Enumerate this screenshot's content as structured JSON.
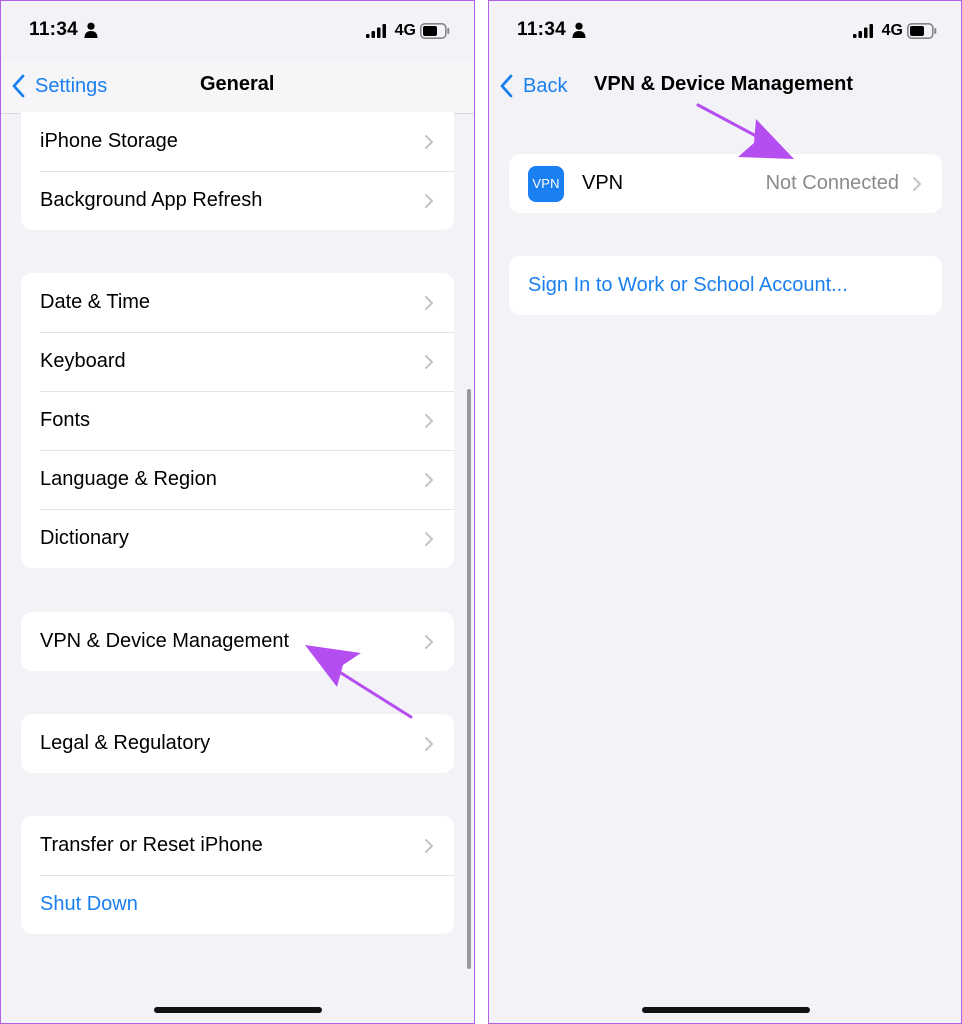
{
  "colors": {
    "accent": "#1a7ff0",
    "annotation_arrow": "#b44ef0",
    "secondary_text": "#8a8a8e"
  },
  "left": {
    "status": {
      "time": "11:34",
      "network": "4G"
    },
    "nav": {
      "back_label": "Settings",
      "title": "General"
    },
    "groups": [
      {
        "items": [
          {
            "label": "iPhone Storage"
          },
          {
            "label": "Background App Refresh"
          }
        ]
      },
      {
        "items": [
          {
            "label": "Date & Time"
          },
          {
            "label": "Keyboard"
          },
          {
            "label": "Fonts"
          },
          {
            "label": "Language & Region"
          },
          {
            "label": "Dictionary"
          }
        ]
      },
      {
        "items": [
          {
            "label": "VPN & Device Management"
          }
        ]
      },
      {
        "items": [
          {
            "label": "Legal & Regulatory"
          }
        ]
      },
      {
        "items": [
          {
            "label": "Transfer or Reset iPhone"
          },
          {
            "label": "Shut Down"
          }
        ]
      }
    ]
  },
  "right": {
    "status": {
      "time": "11:34",
      "network": "4G"
    },
    "nav": {
      "back_label": "Back",
      "title": "VPN & Device Management"
    },
    "vpn_row": {
      "icon_text": "VPN",
      "label": "VPN",
      "status": "Not Connected"
    },
    "account_link": "Sign In to Work or School Account..."
  },
  "icons": [
    "person-icon",
    "signal-icon",
    "battery-icon",
    "chevron-left-icon",
    "chevron-right-icon"
  ]
}
